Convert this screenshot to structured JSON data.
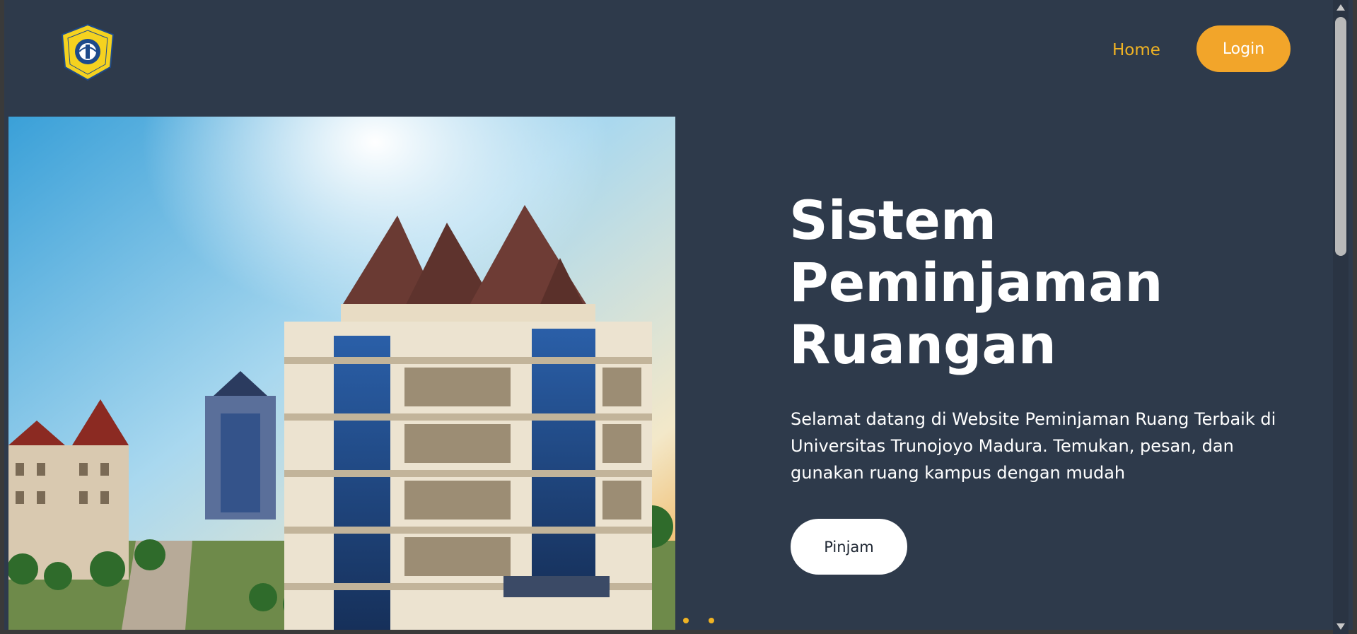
{
  "header": {
    "logo_icon": "university-seal-logo",
    "nav": {
      "home_label": "Home"
    },
    "login_label": "Login"
  },
  "hero": {
    "image_alt": "campus-building-photo",
    "title_lines": [
      "Sistem",
      "Peminjaman",
      "Ruangan"
    ],
    "description": "Selamat datang di Website Peminjaman Ruang Terbaik di Universitas Trunojoyo Madura. Temukan, pesan, dan gunakan ruang kampus dengan mudah",
    "cta_label": "Pinjam"
  },
  "carousel": {
    "dot_count": 2
  },
  "colors": {
    "background": "#2e3a4b",
    "accent": "#f0b323",
    "login_button": "#f2a52a",
    "cta_button": "#ffffff"
  }
}
